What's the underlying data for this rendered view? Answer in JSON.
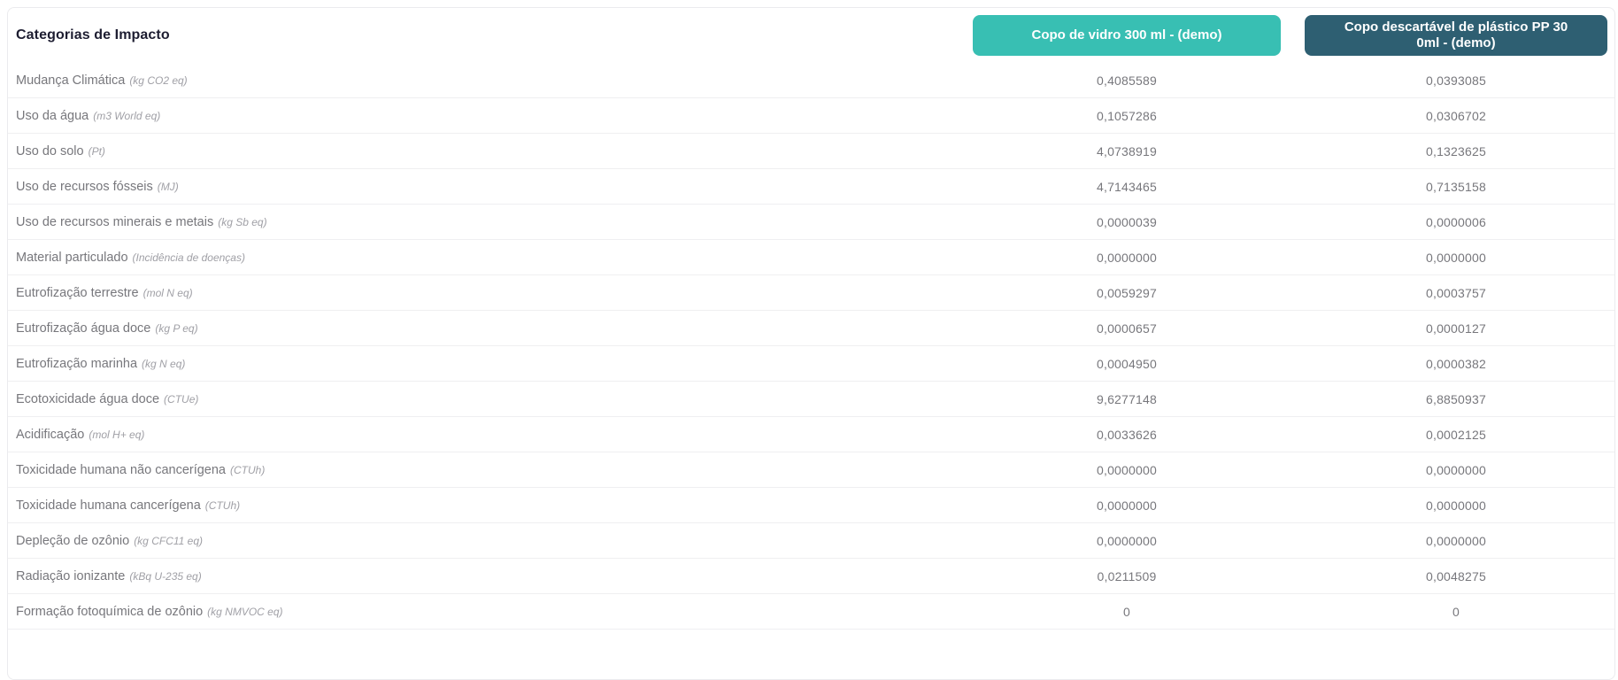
{
  "table": {
    "title": "Categorias de Impacto"
  },
  "columns": [
    {
      "label": "Copo de vidro 300 ml - (demo)",
      "lines": [
        "Copo de vidro 300 ml - (demo)"
      ],
      "color": "#38bfb3"
    },
    {
      "label": "Copo descartável de plástico PP 300ml - (demo)",
      "lines": [
        "Copo descartável de plástico PP 30",
        "0ml - (demo)"
      ],
      "color": "#2e5f72"
    }
  ],
  "rows": [
    {
      "label": "Mudança Climática",
      "unit": "(kg CO2 eq)",
      "values": [
        "0,4085589",
        "0,0393085"
      ]
    },
    {
      "label": "Uso da água",
      "unit": "(m3 World eq)",
      "values": [
        "0,1057286",
        "0,0306702"
      ]
    },
    {
      "label": "Uso do solo",
      "unit": "(Pt)",
      "values": [
        "4,0738919",
        "0,1323625"
      ]
    },
    {
      "label": "Uso de recursos fósseis",
      "unit": "(MJ)",
      "values": [
        "4,7143465",
        "0,7135158"
      ]
    },
    {
      "label": "Uso de recursos minerais e metais",
      "unit": "(kg Sb eq)",
      "values": [
        "0,0000039",
        "0,0000006"
      ]
    },
    {
      "label": "Material particulado",
      "unit": "(Incidência de doenças)",
      "values": [
        "0,0000000",
        "0,0000000"
      ]
    },
    {
      "label": "Eutrofização terrestre",
      "unit": "(mol N eq)",
      "values": [
        "0,0059297",
        "0,0003757"
      ]
    },
    {
      "label": "Eutrofização água doce",
      "unit": "(kg P eq)",
      "values": [
        "0,0000657",
        "0,0000127"
      ]
    },
    {
      "label": "Eutrofização marinha",
      "unit": "(kg N eq)",
      "values": [
        "0,0004950",
        "0,0000382"
      ]
    },
    {
      "label": "Ecotoxicidade água doce",
      "unit": "(CTUe)",
      "values": [
        "9,6277148",
        "6,8850937"
      ]
    },
    {
      "label": "Acidificação",
      "unit": "(mol H+ eq)",
      "values": [
        "0,0033626",
        "0,0002125"
      ]
    },
    {
      "label": "Toxicidade humana não cancerígena",
      "unit": "(CTUh)",
      "values": [
        "0,0000000",
        "0,0000000"
      ]
    },
    {
      "label": "Toxicidade humana cancerígena",
      "unit": "(CTUh)",
      "values": [
        "0,0000000",
        "0,0000000"
      ]
    },
    {
      "label": "Depleção de ozônio",
      "unit": "(kg CFC11 eq)",
      "values": [
        "0,0000000",
        "0,0000000"
      ]
    },
    {
      "label": "Radiação ionizante",
      "unit": "(kBq U-235 eq)",
      "values": [
        "0,0211509",
        "0,0048275"
      ]
    },
    {
      "label": "Formação fotoquímica de ozônio",
      "unit": "(kg NMVOC eq)",
      "values": [
        "0",
        "0"
      ]
    }
  ]
}
